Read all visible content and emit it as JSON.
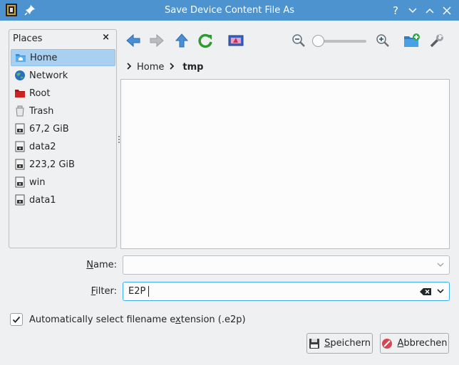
{
  "window": {
    "title": "Save Device Content File As",
    "help_glyph": "?",
    "titlebar_color": "#4c93cf"
  },
  "places": {
    "header": "Places",
    "close_glyph": "×",
    "items": [
      {
        "label": "Home",
        "icon": "home-folder-icon",
        "selected": true
      },
      {
        "label": "Network",
        "icon": "network-globe-icon"
      },
      {
        "label": "Root",
        "icon": "root-folder-icon"
      },
      {
        "label": "Trash",
        "icon": "trash-icon"
      },
      {
        "label": "67,2 GiB",
        "icon": "drive-icon"
      },
      {
        "label": "data2",
        "icon": "drive-icon"
      },
      {
        "label": "223,2 GiB",
        "icon": "drive-icon"
      },
      {
        "label": "win",
        "icon": "drive-icon"
      },
      {
        "label": "data1",
        "icon": "drive-icon"
      }
    ]
  },
  "toolbar": {
    "icons": [
      "back-arrow-icon",
      "forward-arrow-icon",
      "up-arrow-icon",
      "reload-icon",
      "preview-icon",
      "zoom-out-icon",
      "zoom-slider",
      "zoom-in-icon",
      "new-folder-icon",
      "settings-wrench-icon"
    ],
    "zoom_level": 0
  },
  "breadcrumb": {
    "items": [
      "Home"
    ],
    "current": "tmp"
  },
  "form": {
    "name_label_prefix": "N",
    "name_label_rest": "ame:",
    "name_value": "",
    "filter_label_prefix": "F",
    "filter_label_rest": "ilter:",
    "filter_value": "E2P"
  },
  "options": {
    "auto_ext_before": "Automatically select filename e",
    "auto_ext_mnemonic": "x",
    "auto_ext_after": "tension (.e2p)",
    "checked": true
  },
  "buttons": {
    "save_mnemonic": "S",
    "save_rest": "peichern",
    "cancel_mnemonic": "A",
    "cancel_rest": "bbrechen"
  },
  "colors": {
    "accent": "#3daee9",
    "selection": "#a9d0f1"
  }
}
